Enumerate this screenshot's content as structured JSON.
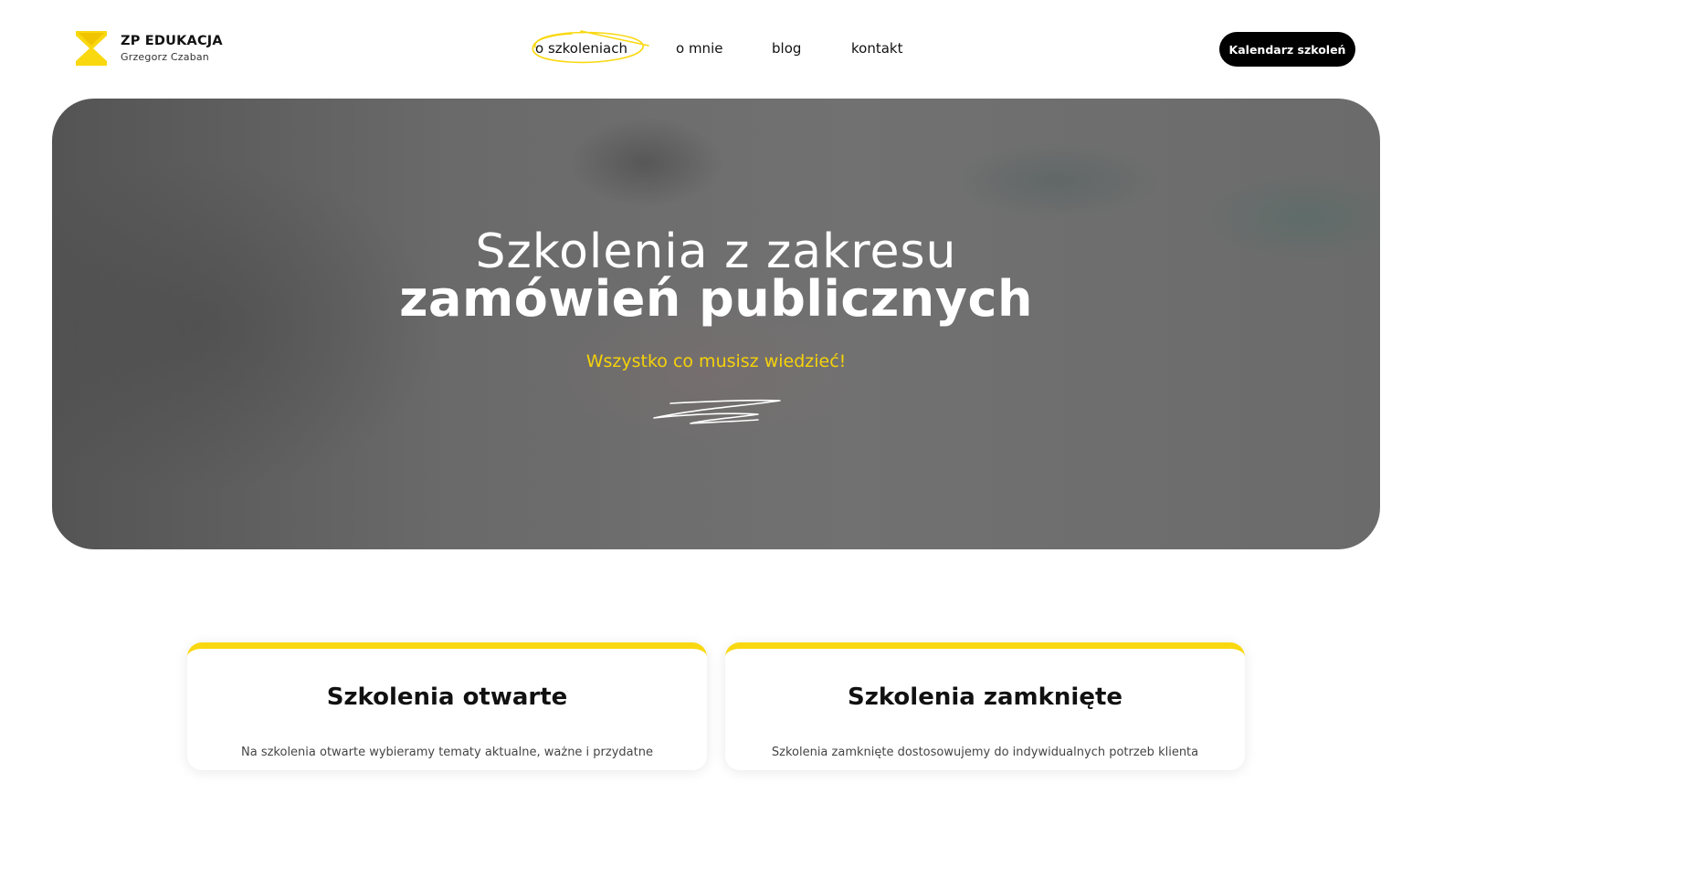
{
  "brand": {
    "title": "ZP EDUKACJA",
    "subtitle": "Grzegorz Czaban",
    "accent_color": "#f9d80f"
  },
  "nav": {
    "items": [
      {
        "label": "o szkoleniach",
        "active": true
      },
      {
        "label": "o mnie"
      },
      {
        "label": "blog"
      },
      {
        "label": "kontakt"
      }
    ]
  },
  "cta": {
    "label": "Kalendarz szkoleń"
  },
  "hero": {
    "line1": "Szkolenia z zakresu",
    "line2": "zamówień publicznych",
    "subtitle": "Wszystko co musisz wiedzieć!",
    "subtitle_color": "#f5d20a"
  },
  "cards": [
    {
      "title": "Szkolenia otwarte",
      "text": "Na szkolenia otwarte wybieramy tematy aktualne, ważne i przydatne"
    },
    {
      "title": "Szkolenia zamknięte",
      "text": "Szkolenia zamknięte dostosowujemy do indywidualnych potrzeb klienta"
    }
  ]
}
